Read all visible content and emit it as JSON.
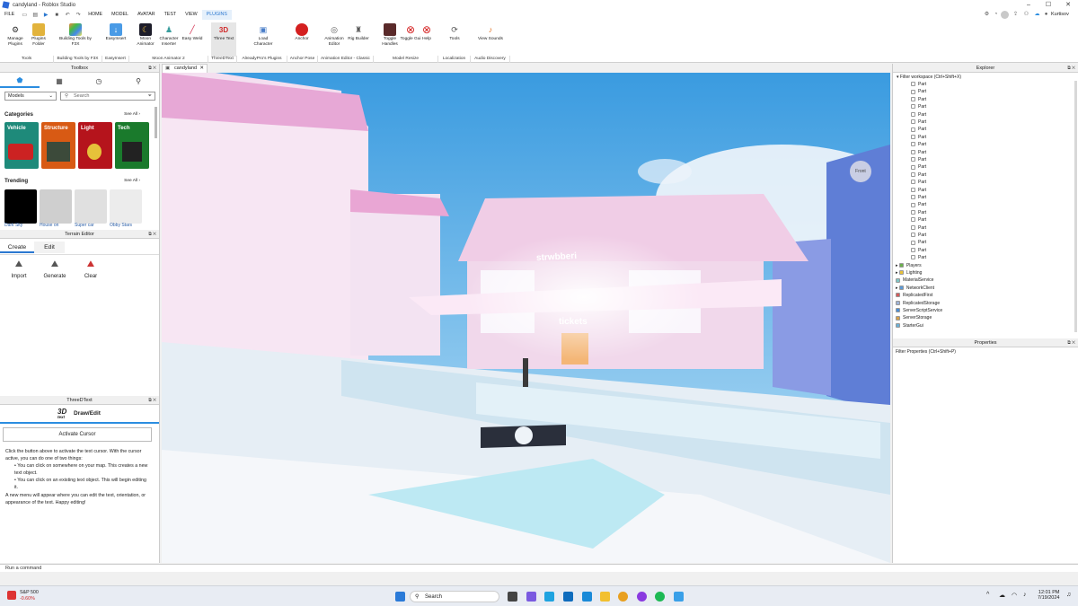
{
  "window": {
    "title": "candyland - Roblox Studio",
    "user": "Kurtisov"
  },
  "menu": [
    "FILE",
    "HOME",
    "MODEL",
    "AVATAR",
    "TEST",
    "VIEW",
    "PLUGINS"
  ],
  "menu_active": "PLUGINS",
  "ribbon": {
    "buttons": [
      {
        "label": "Manage Plugins",
        "icon": "gear-icon"
      },
      {
        "label": "Plugins Folder",
        "icon": "folder-icon"
      },
      {
        "label": "Building Tools by F3X",
        "icon": "f3x-icon"
      },
      {
        "label": "EasyInsert",
        "icon": "download-icon"
      },
      {
        "label": "Moon Animator",
        "icon": "moon-icon"
      },
      {
        "label": "Character Inserter",
        "icon": "character-icon"
      },
      {
        "label": "Easy Weld",
        "icon": "weld-icon"
      },
      {
        "label": "Three Text",
        "icon": "3d-text-icon"
      },
      {
        "label": "Load Character",
        "icon": "load-character-icon"
      },
      {
        "label": "Anchor",
        "icon": "anchor-icon"
      },
      {
        "label": "Animation Editor",
        "icon": "animation-icon"
      },
      {
        "label": "Rig Builder",
        "icon": "rig-icon"
      },
      {
        "label": "Toggle Handles",
        "icon": "handles-icon"
      },
      {
        "label": "Toggle Gui",
        "icon": "toggle-gui-icon"
      },
      {
        "label": "Help",
        "icon": "help-icon"
      },
      {
        "label": "Tools",
        "icon": "tools-icon"
      },
      {
        "label": "View Sounds",
        "icon": "sound-icon"
      }
    ],
    "groups": [
      "Tools",
      "Building Tools by F3X",
      "EasyInsert",
      "Moon Animator 2",
      "ThreeDText",
      "AlreadyPro's Plugins",
      "Anchor Pose",
      "Animation Editor - Classic",
      "Model Resize",
      "Localization",
      "Audio Discovery"
    ]
  },
  "toolbox": {
    "title": "Toolbox",
    "dropdown": "Models",
    "search_placeholder": "Search",
    "categories_title": "Categories",
    "trending_title": "Trending",
    "see_all": "See All ›",
    "categories": [
      "Vehicle",
      "Structure",
      "Light",
      "Tech"
    ],
    "trending": [
      "Dark Sky",
      "House on",
      "Super car",
      "Obby Stars"
    ]
  },
  "terrain": {
    "title": "Terrain Editor",
    "tabs": [
      "Create",
      "Edit"
    ],
    "tools": [
      "Import",
      "Generate",
      "Clear"
    ]
  },
  "threedtext": {
    "title": "ThreeDText",
    "header": "Draw/Edit",
    "logo": "3D",
    "logo_sub": "text",
    "button": "Activate Cursor",
    "intro": "Click the button above to activate the text cursor. With the cursor active, you can do one of two things:",
    "bullet1": "• You can click on somewhere on your map. This creates a new text object.",
    "bullet2": "• You can click on an existing text object. This will begin editing it.",
    "outro": "A new menu will appear where you can edit the text, orientation, or appearance of the text. Happy editing!"
  },
  "viewport": {
    "tab": "candyland",
    "sign": "strwbberi",
    "tickets": "tickets",
    "front": "Front"
  },
  "explorer": {
    "title": "Explorer",
    "filter": "Filter workspace (Ctrl+Shift+X)",
    "parts": [
      "Part",
      "Part",
      "Part",
      "Part",
      "Part",
      "Part",
      "Part",
      "Part",
      "Part",
      "Part",
      "Part",
      "Part",
      "Part",
      "Part",
      "Part",
      "Part",
      "Part",
      "Part",
      "Part",
      "Part",
      "Part",
      "Part",
      "Part",
      "Part"
    ],
    "services": [
      "Players",
      "Lighting",
      "MaterialService",
      "NetworkClient",
      "ReplicatedFirst",
      "ReplicatedStorage",
      "ServerScriptService",
      "ServerStorage",
      "StarterGui"
    ]
  },
  "properties": {
    "title": "Properties",
    "filter": "Filter Properties (Ctrl+Shift+P)"
  },
  "command": {
    "placeholder": "Run a command"
  },
  "taskbar": {
    "stock_name": "S&P 500",
    "stock_change": "-0.60%",
    "search": "Search",
    "time": "12:01 PM",
    "date": "7/19/2024"
  },
  "colors": {
    "accent": "#2b78d0",
    "sky": "#6fb8ec"
  }
}
